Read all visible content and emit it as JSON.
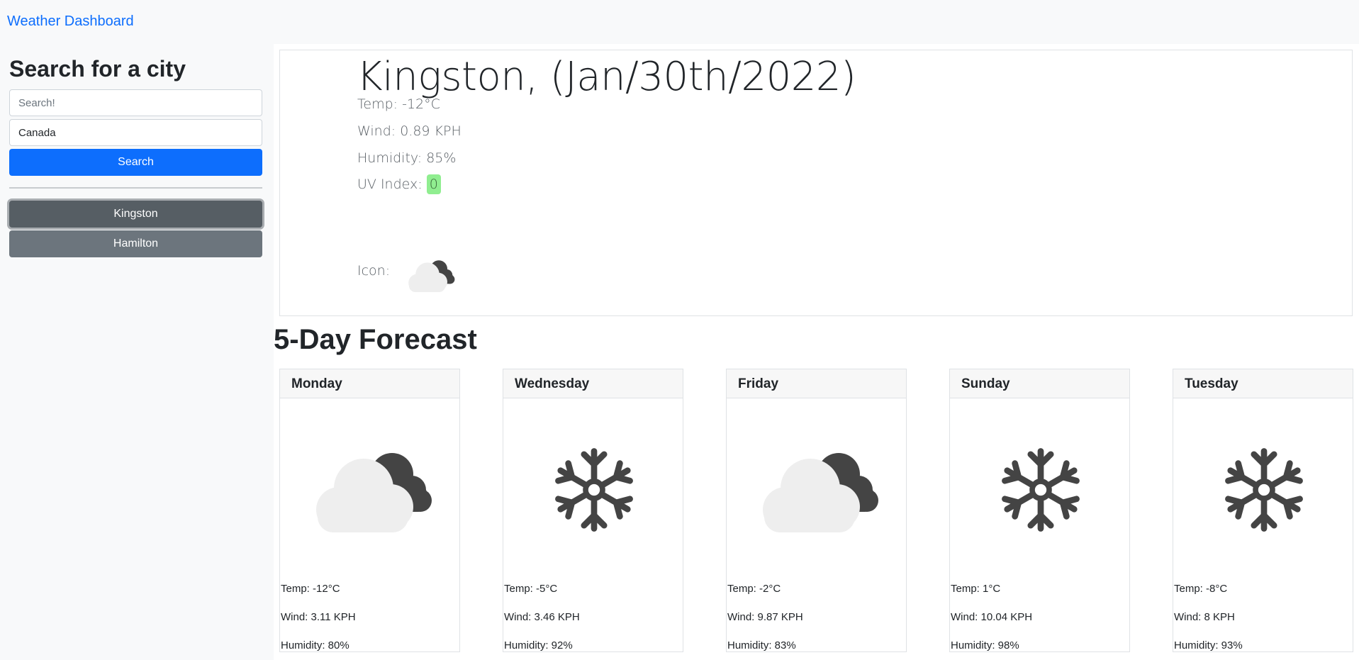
{
  "brand": "Weather Dashboard",
  "search": {
    "heading": "Search for a city",
    "city_placeholder": "Search!",
    "country_value": "Canada",
    "button_label": "Search"
  },
  "history": [
    {
      "label": "Kingston",
      "active": true
    },
    {
      "label": "Hamilton",
      "active": false
    }
  ],
  "current": {
    "title": "Kingston, (Jan/30th/2022)",
    "temp": "Temp: -12°C",
    "wind": "Wind: 0.89 KPH",
    "humidity": "Humidity: 85%",
    "uv_label": "UV Index: ",
    "uv_value": "0",
    "icon_label": "Icon:",
    "icon": "partly-cloudy-icon"
  },
  "forecast": {
    "title": "5-Day Forecast",
    "days": [
      {
        "day": "Monday",
        "icon": "partly-cloudy-icon",
        "temp": "Temp: -12°C",
        "wind": "Wind: 3.11 KPH",
        "humidity": "Humidity: 80%"
      },
      {
        "day": "Wednesday",
        "icon": "snowflake-icon",
        "temp": "Temp: -5°C",
        "wind": "Wind: 3.46 KPH",
        "humidity": "Humidity: 92%"
      },
      {
        "day": "Friday",
        "icon": "partly-cloudy-icon",
        "temp": "Temp: -2°C",
        "wind": "Wind: 9.87 KPH",
        "humidity": "Humidity: 83%"
      },
      {
        "day": "Sunday",
        "icon": "snowflake-icon",
        "temp": "Temp: 1°C",
        "wind": "Wind: 10.04 KPH",
        "humidity": "Humidity: 98%"
      },
      {
        "day": "Tuesday",
        "icon": "snowflake-icon",
        "temp": "Temp: -8°C",
        "wind": "Wind: 8 KPH",
        "humidity": "Humidity: 93%"
      }
    ]
  },
  "colors": {
    "primary": "#0d6efd",
    "secondary": "#6c757d",
    "uv_low": "#90ee90",
    "icon_dark": "#444444",
    "icon_light": "#eeeeee"
  }
}
